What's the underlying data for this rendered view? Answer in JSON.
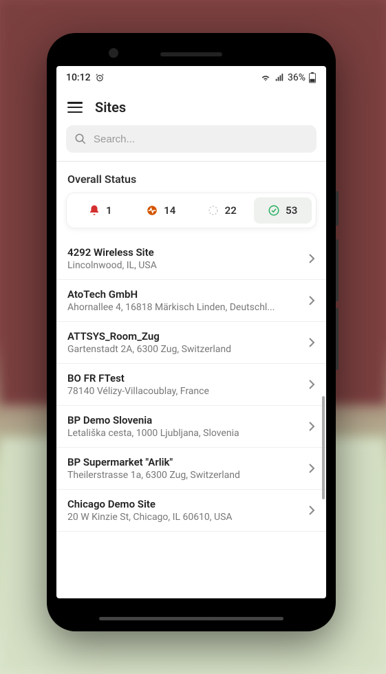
{
  "statusbar": {
    "time": "10:12",
    "battery": "36%"
  },
  "header": {
    "title": "Sites"
  },
  "search": {
    "placeholder": "Search..."
  },
  "overall": {
    "label": "Overall Status",
    "items": [
      {
        "icon": "bell",
        "count": "1",
        "color": "#d32f2f",
        "active": false
      },
      {
        "icon": "heartbeat",
        "count": "14",
        "color": "#e67e22",
        "active": false
      },
      {
        "icon": "loading",
        "count": "22",
        "color": "#bbb",
        "active": false
      },
      {
        "icon": "check",
        "count": "53",
        "color": "#27ae60",
        "active": true
      }
    ]
  },
  "sites": [
    {
      "name": "4292 Wireless Site",
      "address": "Lincolnwood, IL, USA"
    },
    {
      "name": "AtoTech GmbH",
      "address": "Ahornallee 4, 16818 Märkisch Linden, Deutschl..."
    },
    {
      "name": "ATTSYS_Room_Zug",
      "address": "Gartenstadt 2A, 6300 Zug, Switzerland"
    },
    {
      "name": "BO FR FTest",
      "address": "78140 Vélizy-Villacoublay, France"
    },
    {
      "name": "BP Demo Slovenia",
      "address": "Letališka cesta, 1000 Ljubljana, Slovenia"
    },
    {
      "name": "BP Supermarket \"Arlik\"",
      "address": "Theilerstrasse 1a, 6300 Zug, Switzerland"
    },
    {
      "name": "Chicago Demo Site",
      "address": "20 W Kinzie St, Chicago, IL 60610, USA"
    }
  ]
}
